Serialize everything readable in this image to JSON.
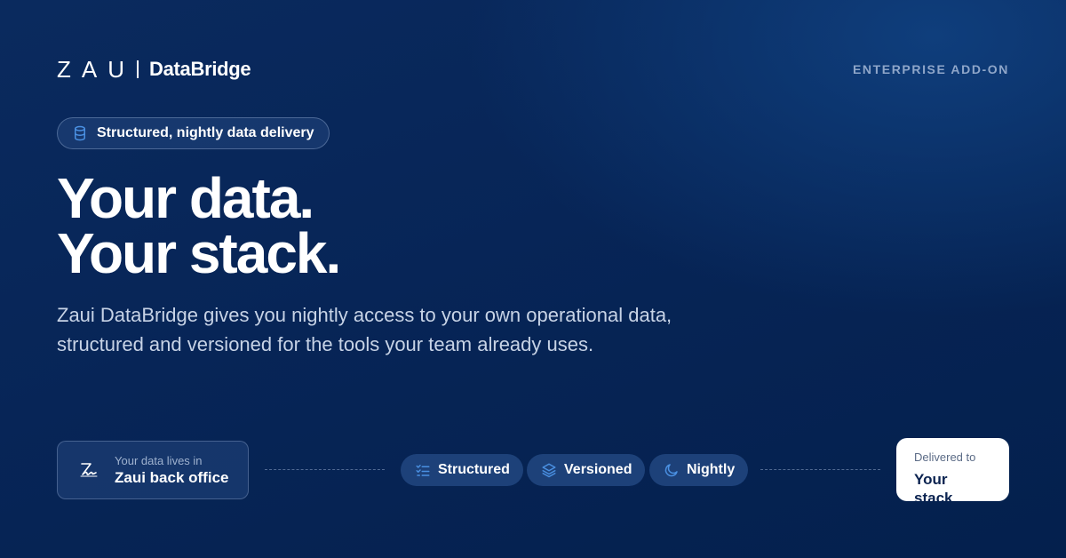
{
  "brand": {
    "mark": "ZAU",
    "product": "DataBridge"
  },
  "header": {
    "tag": "ENTERPRISE ADD-ON"
  },
  "pill": {
    "icon": "database-icon",
    "label": "Structured, nightly data delivery"
  },
  "headline": {
    "line1": "Your data.",
    "line2": "Your stack."
  },
  "subtitle": "Zaui DataBridge gives you nightly access to your own operational data, structured and versioned for the tools your team already uses.",
  "flow": {
    "source": {
      "icon": "signature-icon",
      "caption": "Your data lives in",
      "title": "Zaui back office"
    },
    "chips": [
      {
        "icon": "checklist-icon",
        "label": "Structured"
      },
      {
        "icon": "layers-icon",
        "label": "Versioned"
      },
      {
        "icon": "moon-icon",
        "label": "Nightly"
      }
    ],
    "destination": {
      "caption": "Delivered to",
      "title": "Your stack"
    }
  },
  "colors": {
    "background": "#072557",
    "accent": "#4a90e2",
    "muted": "#8fa6c9"
  }
}
